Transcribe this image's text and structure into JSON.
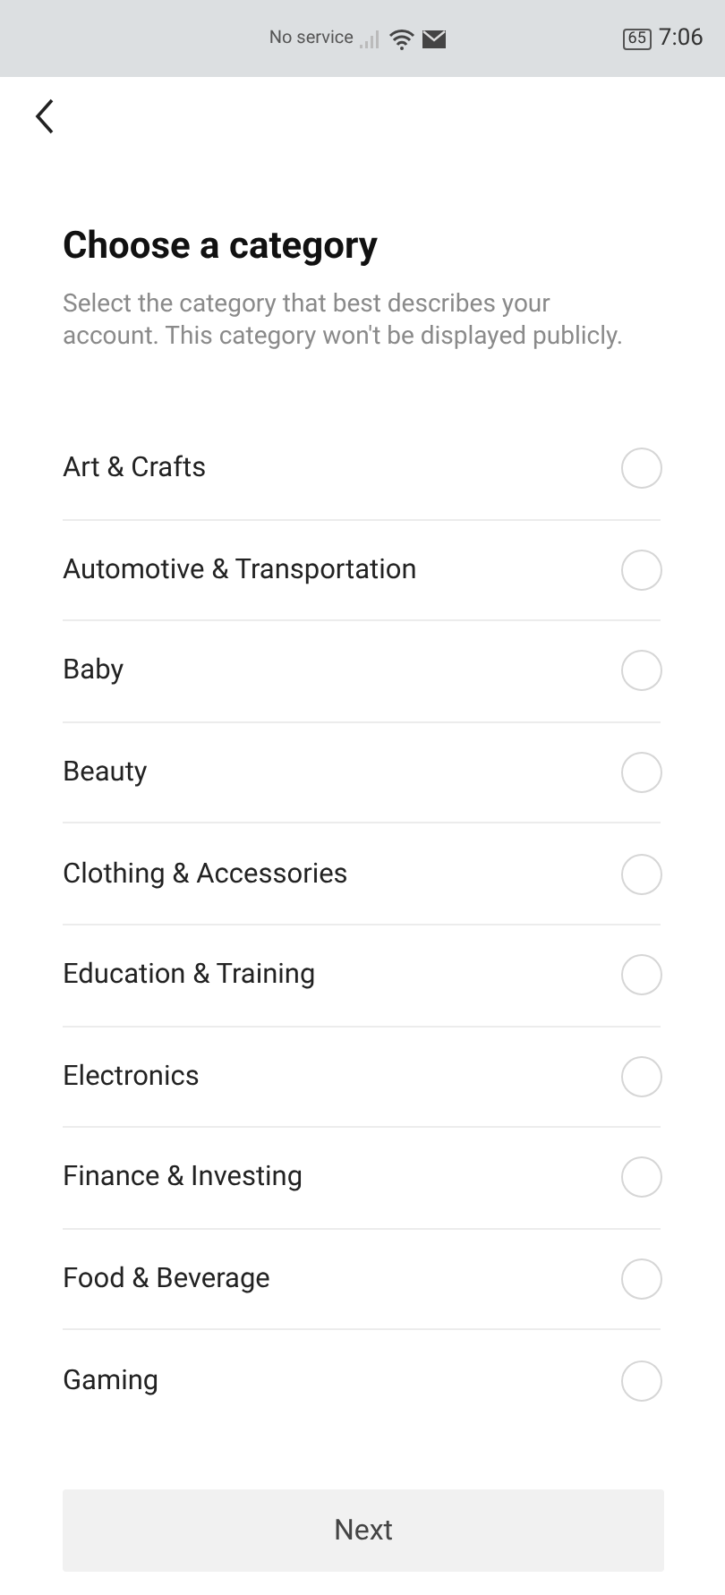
{
  "status_bar": {
    "carrier": "No service",
    "battery": "65",
    "time": "7:06"
  },
  "title": "Choose a category",
  "description": "Select the category that best describes your account. This category won't be displayed publicly.",
  "categories": [
    {
      "label": "Art & Crafts",
      "selected": false
    },
    {
      "label": "Automotive & Transportation",
      "selected": false
    },
    {
      "label": "Baby",
      "selected": false
    },
    {
      "label": "Beauty",
      "selected": false
    },
    {
      "label": "Clothing & Accessories",
      "selected": false
    },
    {
      "label": "Education & Training",
      "selected": false
    },
    {
      "label": "Electronics",
      "selected": false
    },
    {
      "label": "Finance & Investing",
      "selected": false
    },
    {
      "label": "Food & Beverage",
      "selected": false
    },
    {
      "label": "Gaming",
      "selected": false
    }
  ],
  "next_button": {
    "label": "Next",
    "disabled": true
  }
}
